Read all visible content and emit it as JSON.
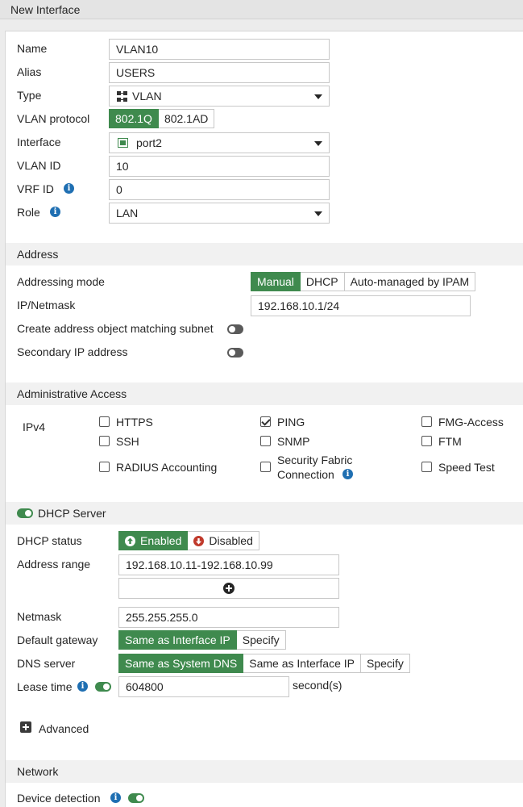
{
  "window": {
    "title": "New Interface"
  },
  "general": {
    "name_label": "Name",
    "name_value": "VLAN10",
    "alias_label": "Alias",
    "alias_value": "USERS",
    "type_label": "Type",
    "type_value": "VLAN",
    "vlan_protocol_label": "VLAN protocol",
    "vlan_protocol_options": [
      "802.1Q",
      "802.1AD"
    ],
    "interface_label": "Interface",
    "interface_value": "port2",
    "vlan_id_label": "VLAN ID",
    "vlan_id_value": "10",
    "vrf_id_label": "VRF ID",
    "vrf_id_value": "0",
    "role_label": "Role",
    "role_value": "LAN"
  },
  "address": {
    "header": "Address",
    "addressing_mode_label": "Addressing mode",
    "addressing_mode_options": [
      "Manual",
      "DHCP",
      "Auto-managed by IPAM"
    ],
    "ip_netmask_label": "IP/Netmask",
    "ip_netmask_value": "192.168.10.1/24",
    "create_object_label": "Create address object matching subnet",
    "secondary_ip_label": "Secondary IP address"
  },
  "admin_access": {
    "header": "Administrative Access",
    "ipv4_label": "IPv4",
    "items": [
      {
        "label": "HTTPS",
        "checked": false
      },
      {
        "label": "PING",
        "checked": true
      },
      {
        "label": "FMG-Access",
        "checked": false
      },
      {
        "label": "SSH",
        "checked": false
      },
      {
        "label": "SNMP",
        "checked": false
      },
      {
        "label": "FTM",
        "checked": false
      },
      {
        "label": "RADIUS Accounting",
        "checked": false
      },
      {
        "label": "Security Fabric",
        "label2": "Connection",
        "checked": false
      },
      {
        "label": "Speed Test",
        "checked": false
      }
    ]
  },
  "dhcp": {
    "header": "DHCP Server",
    "status_label": "DHCP status",
    "enabled_label": "Enabled",
    "disabled_label": "Disabled",
    "address_range_label": "Address range",
    "address_range_value": "192.168.10.11-192.168.10.99",
    "netmask_label": "Netmask",
    "netmask_value": "255.255.255.0",
    "default_gateway_label": "Default gateway",
    "default_gateway_options": [
      "Same as Interface IP",
      "Specify"
    ],
    "dns_server_label": "DNS server",
    "dns_server_options": [
      "Same as System DNS",
      "Same as Interface IP",
      "Specify"
    ],
    "lease_time_label": "Lease time",
    "lease_time_value": "604800",
    "lease_time_unit": "second(s)",
    "advanced_label": "Advanced"
  },
  "network": {
    "header": "Network",
    "device_detection_label": "Device detection"
  },
  "colors": {
    "accent_green": "#3f8a4e",
    "info_blue": "#1f6fb2",
    "disabled_red": "#c0392b"
  }
}
